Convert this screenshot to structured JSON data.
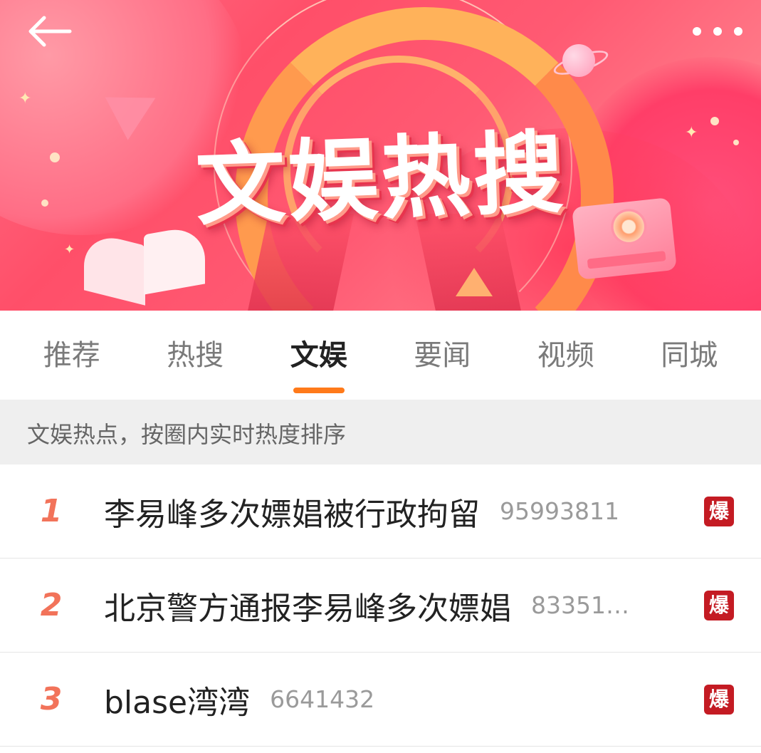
{
  "banner": {
    "title": "文娱热搜"
  },
  "tabs": [
    {
      "label": "推荐",
      "active": false
    },
    {
      "label": "热搜",
      "active": false
    },
    {
      "label": "文娱",
      "active": true
    },
    {
      "label": "要闻",
      "active": false
    },
    {
      "label": "视频",
      "active": false
    },
    {
      "label": "同城",
      "active": false
    }
  ],
  "subtitle": "文娱热点，按圈内实时热度排序",
  "list": [
    {
      "rank": "1",
      "title": "李易峰多次嫖娼被行政拘留",
      "count": "95993811",
      "badge": "爆"
    },
    {
      "rank": "2",
      "title": "北京警方通报李易峰多次嫖娼",
      "count": "833511...",
      "badge": "爆"
    },
    {
      "rank": "3",
      "title": "blase湾湾",
      "count": "6641432",
      "badge": "爆"
    }
  ],
  "colors": {
    "accent": "#ff7a1a",
    "rank": "#f2735a",
    "badge": "#c41b23"
  },
  "icons": {
    "back": "back-arrow-icon",
    "more": "more-dots-icon"
  }
}
